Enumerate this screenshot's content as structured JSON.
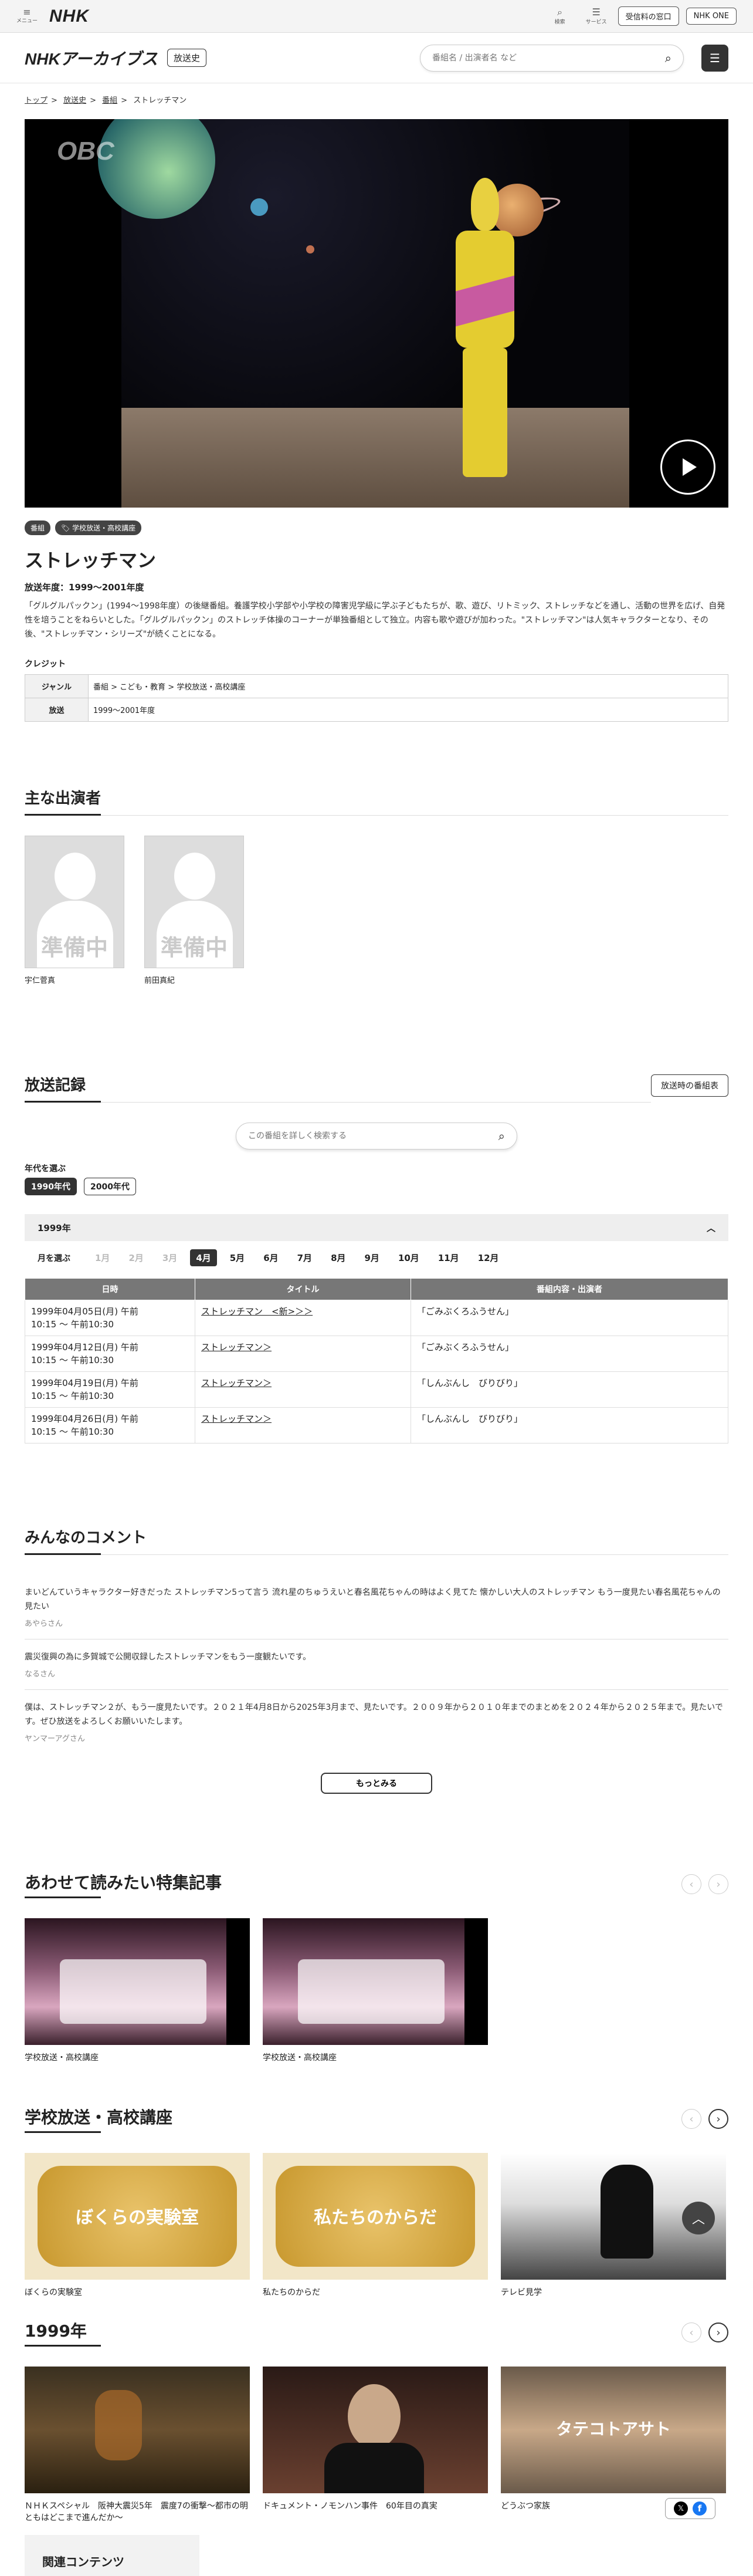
{
  "topbar": {
    "menu_label": "メニュー",
    "logo": "NHK",
    "search_label": "検索",
    "service_label": "サービス",
    "fee_button": "受信料の窓口",
    "nhkone_button": "NHK ONE"
  },
  "header": {
    "logo": "NHKアーカイブス",
    "tag": "放送史",
    "search_placeholder": "番組名 / 出演者名 など"
  },
  "breadcrumb": [
    "トップ",
    "放送史",
    "番組",
    "ストレッチマン"
  ],
  "hero": {
    "watermark": "OBC"
  },
  "badges": [
    "番組",
    "学校放送・高校講座"
  ],
  "program": {
    "title": "ストレッチマン",
    "air_years": "放送年度：1999〜2001年度",
    "description": "「グルグルパックン」(1994〜1998年度）の後継番組。養護学校小学部や小学校の障害児学級に学ぶ子どもたちが、歌、遊び、リトミック、ストレッチなどを通し、活動の世界を広げ、自発性を培うことをねらいとした。「グルグルパックン」のストレッチ体操のコーナーが単独番組として独立。内容も歌や遊びが加わった。\"ストレッチマン\"は人気キャラクターとなり、その後、\"ストレッチマン・シリーズ\"が続くことになる。",
    "credit_heading": "クレジット",
    "credits": [
      {
        "key": "ジャンル",
        "value": "番組 > こども・教育 > 学校放送・高校講座"
      },
      {
        "key": "放送",
        "value": "1999〜2001年度"
      }
    ]
  },
  "cast": {
    "title": "主な出演者",
    "placeholder_mark": "準備中",
    "members": [
      {
        "name": "宇仁菅真"
      },
      {
        "name": "前田真紀"
      }
    ]
  },
  "broadcast": {
    "title": "放送記録",
    "schedule_button": "放送時の番組表",
    "search_placeholder": "この番組を詳しく検索する",
    "decade_label": "年代を選ぶ",
    "decades": [
      "1990年代",
      "2000年代"
    ],
    "year": "1999年",
    "month_label": "月を選ぶ",
    "months": [
      "1月",
      "2月",
      "3月",
      "4月",
      "5月",
      "6月",
      "7月",
      "8月",
      "9月",
      "10月",
      "11月",
      "12月"
    ],
    "columns": [
      "日時",
      "タイトル",
      "番組内容・出演者"
    ],
    "rows": [
      {
        "date": "1999年04月05日(月) 午前",
        "time": "10:15 〜 午前10:30",
        "title": "ストレッチマン　<新>＞＞",
        "content": "「ごみぶくろふうせん」"
      },
      {
        "date": "1999年04月12日(月) 午前",
        "time": "10:15 〜 午前10:30",
        "title": "ストレッチマン＞",
        "content": "「ごみぶくろふうせん」"
      },
      {
        "date": "1999年04月19日(月) 午前",
        "time": "10:15 〜 午前10:30",
        "title": "ストレッチマン＞",
        "content": "「しんぶんし　びりびり」"
      },
      {
        "date": "1999年04月26日(月) 午前",
        "time": "10:15 〜 午前10:30",
        "title": "ストレッチマン＞",
        "content": "「しんぶんし　びりびり」"
      }
    ]
  },
  "comments": {
    "title": "みんなのコメント",
    "items": [
      {
        "text": "まいどんていうキャラクター好きだった ストレッチマン5って言う 流れ星のちゅうえいと春名風花ちゃんの時はよく見てた 懐かしい大人のストレッチマン もう一度見たい春名風花ちゃんの見たい",
        "author": "あやらさん"
      },
      {
        "text": "震災復興の為に多賀城で公開収録したストレッチマンをもう一度観たいです。",
        "author": "なるさん"
      },
      {
        "text": "僕は、ストレッチマン２が、もう一度見たいです。２０２１年4月8日から2025年3月まで、見たいです。２００９年から２０１０年までのまとめを２０２４年から２０２５年まで。見たいです。ぜひ放送をよろしくお願いいたします。",
        "author": "ヤンマーアグさん"
      }
    ],
    "more_button": "もっとみる"
  },
  "featured": {
    "title": "あわせて読みたい特集記事",
    "cards": [
      {
        "caption": "学校放送・高校講座"
      },
      {
        "caption": "学校放送・高校講座"
      }
    ]
  },
  "school": {
    "title": "学校放送・高校講座",
    "cards": [
      {
        "caption": "ぼくらの実験室",
        "thumb_text": "ぼくらの実験室"
      },
      {
        "caption": "私たちのからだ",
        "thumb_text": "私たちのからだ"
      },
      {
        "caption": "テレビ見学"
      }
    ]
  },
  "year1999": {
    "title": "1999年",
    "cards": [
      {
        "caption": "ＮＨＫスペシャル　阪神大震災5年　震度7の衝撃〜都市の明ともはどこまで進んだか〜"
      },
      {
        "caption": "ドキュメント・ノモンハン事件　60年目の真実"
      },
      {
        "caption": "どうぶつ家族",
        "thumb_text": "タテコトアサト"
      }
    ]
  },
  "related": {
    "title": "関連コンテンツ"
  },
  "icons": {
    "menu": "hamburger-icon",
    "search": "search-icon",
    "service": "grid-icon",
    "play": "play-icon",
    "tag": "tag-icon",
    "chevron_up": "chevron-up-icon",
    "arrow_left": "arrow-left-icon",
    "arrow_right": "arrow-right-icon",
    "scroll_top": "scroll-top-icon",
    "x": "x-icon",
    "facebook": "facebook-icon"
  }
}
